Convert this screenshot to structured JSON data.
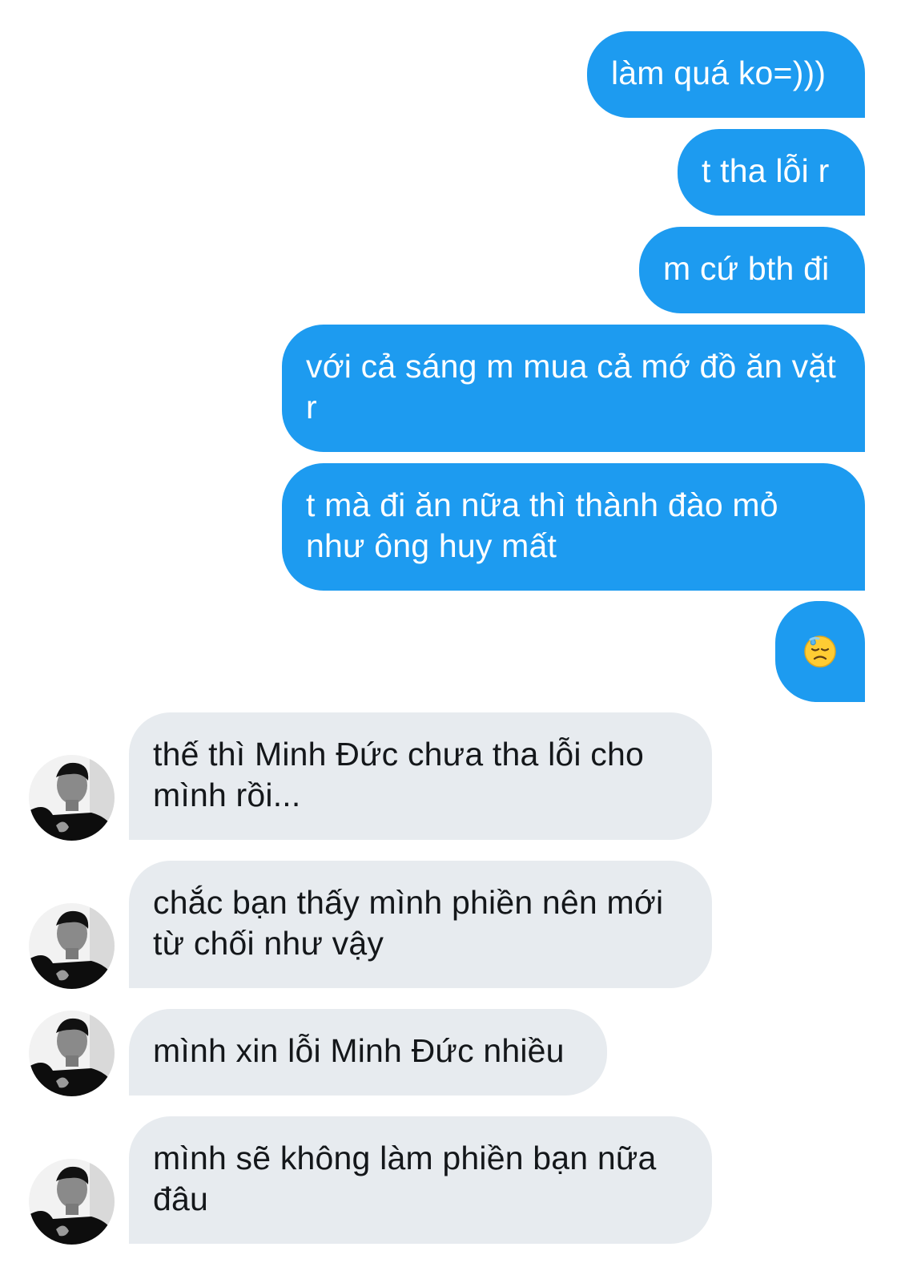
{
  "colors": {
    "sent_bubble": "#1d9bf0",
    "received_bubble": "#e7ebef",
    "sent_text": "#ffffff",
    "received_text": "#14171a"
  },
  "messages": [
    {
      "side": "sent",
      "text": "làm quá ko=)))"
    },
    {
      "side": "sent",
      "text": "t tha lỗi r"
    },
    {
      "side": "sent",
      "text": "m cứ bth đi"
    },
    {
      "side": "sent",
      "text": "với cả sáng m mua cả mớ đồ ăn vặt r"
    },
    {
      "side": "sent",
      "text": "t mà đi ăn nữa thì thành đào mỏ như ông huy mất"
    },
    {
      "side": "sent",
      "emoji": "downcast-face-with-sweat-icon"
    },
    {
      "side": "received",
      "text": "thế thì Minh Đức chưa tha lỗi cho mình rồi..."
    },
    {
      "side": "received",
      "text": "chắc bạn thấy mình phiền nên mới từ chối như vậy"
    },
    {
      "side": "received",
      "text": "mình xin lỗi Minh Đức nhiều"
    },
    {
      "side": "received",
      "text": "mình sẽ không làm phiền bạn nữa đâu"
    }
  ]
}
